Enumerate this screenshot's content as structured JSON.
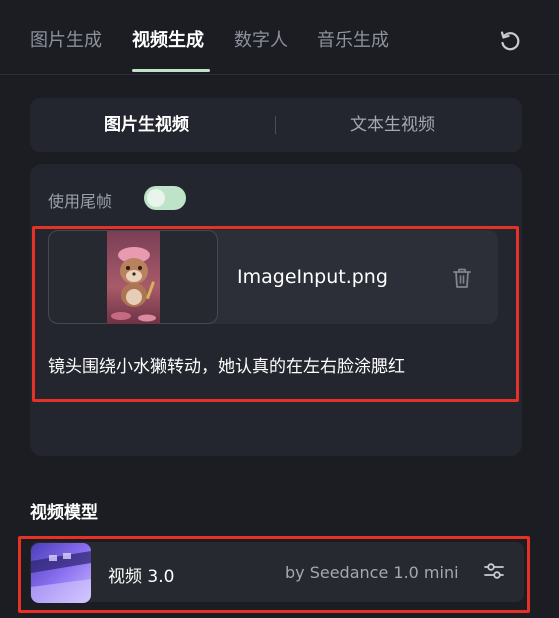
{
  "tabs": [
    {
      "label": "图片生成",
      "active": false
    },
    {
      "label": "视频生成",
      "active": true
    },
    {
      "label": "数字人",
      "active": false
    },
    {
      "label": "音乐生成",
      "active": false
    }
  ],
  "mode_switch": {
    "options": [
      "图片生视频",
      "文本生视频"
    ],
    "selected": "图片生视频"
  },
  "tail_frame": {
    "label": "使用尾帧",
    "enabled": true
  },
  "image_input": {
    "file_name": "ImageInput.png"
  },
  "prompt": {
    "text": "镜头围绕小水獭转动，她认真的在左右脸涂腮红"
  },
  "model_section": {
    "title": "视频模型",
    "model_name": "视频 3.0",
    "provider": "by Seedance 1.0 mini"
  },
  "icons": {
    "refresh": "refresh-icon",
    "trash": "trash-icon",
    "settings": "sliders-icon"
  },
  "colors": {
    "background": "#1b1d23",
    "accent": "#bfe3c8",
    "highlight": "#e63226"
  }
}
